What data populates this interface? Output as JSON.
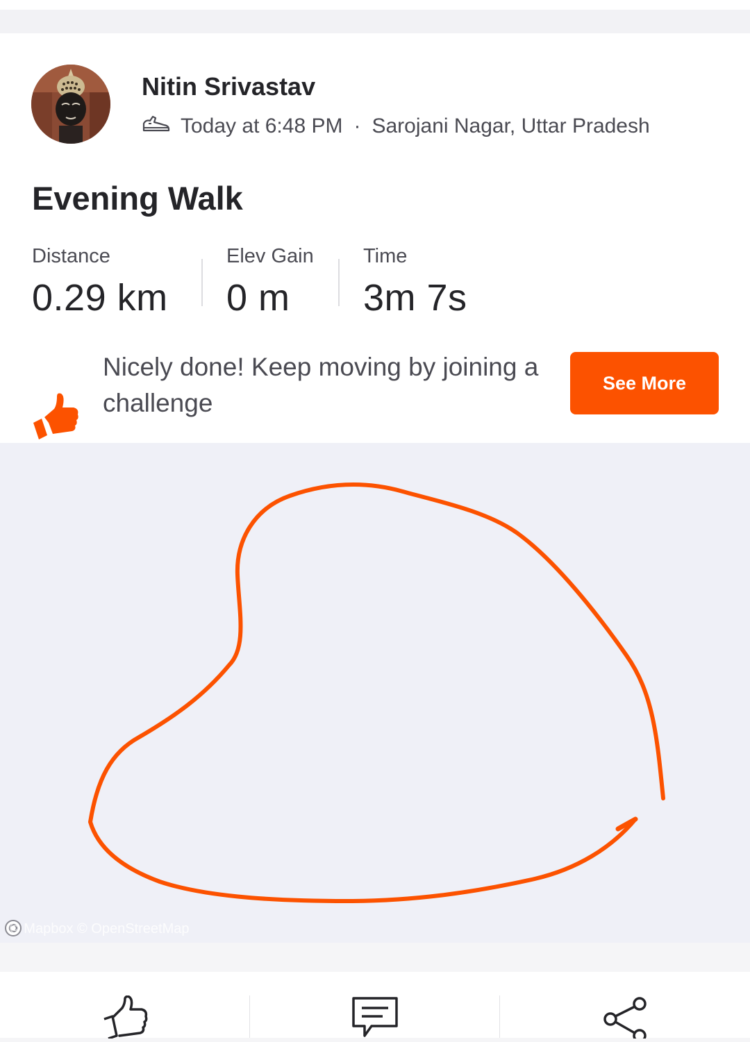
{
  "athlete": {
    "name": "Nitin Srivastav",
    "time": "Today at 6:48 PM",
    "separator": "·",
    "location": "Sarojani Nagar, Uttar Pradesh",
    "activity_icon": "walking-shoe-icon"
  },
  "activity": {
    "title": "Evening Walk",
    "stats": [
      {
        "label": "Distance",
        "value": "0.29 km"
      },
      {
        "label": "Elev Gain",
        "value": "0 m"
      },
      {
        "label": "Time",
        "value": "3m 7s"
      }
    ]
  },
  "promo": {
    "text": "Nicely done! Keep moving by joining a challenge",
    "button_label": "See More",
    "icon": "thumbs-up-icon"
  },
  "map": {
    "attribution": "© Mapbox © OpenStreetMap",
    "route_color": "#fc5200",
    "background_color": "#eff0f7"
  },
  "actions": [
    {
      "name": "kudos",
      "icon": "thumbs-up-icon"
    },
    {
      "name": "comment",
      "icon": "comment-icon"
    },
    {
      "name": "share",
      "icon": "share-icon"
    }
  ],
  "colors": {
    "accent": "#fc5200",
    "text_primary": "#242428",
    "text_secondary": "#4a4a52"
  }
}
